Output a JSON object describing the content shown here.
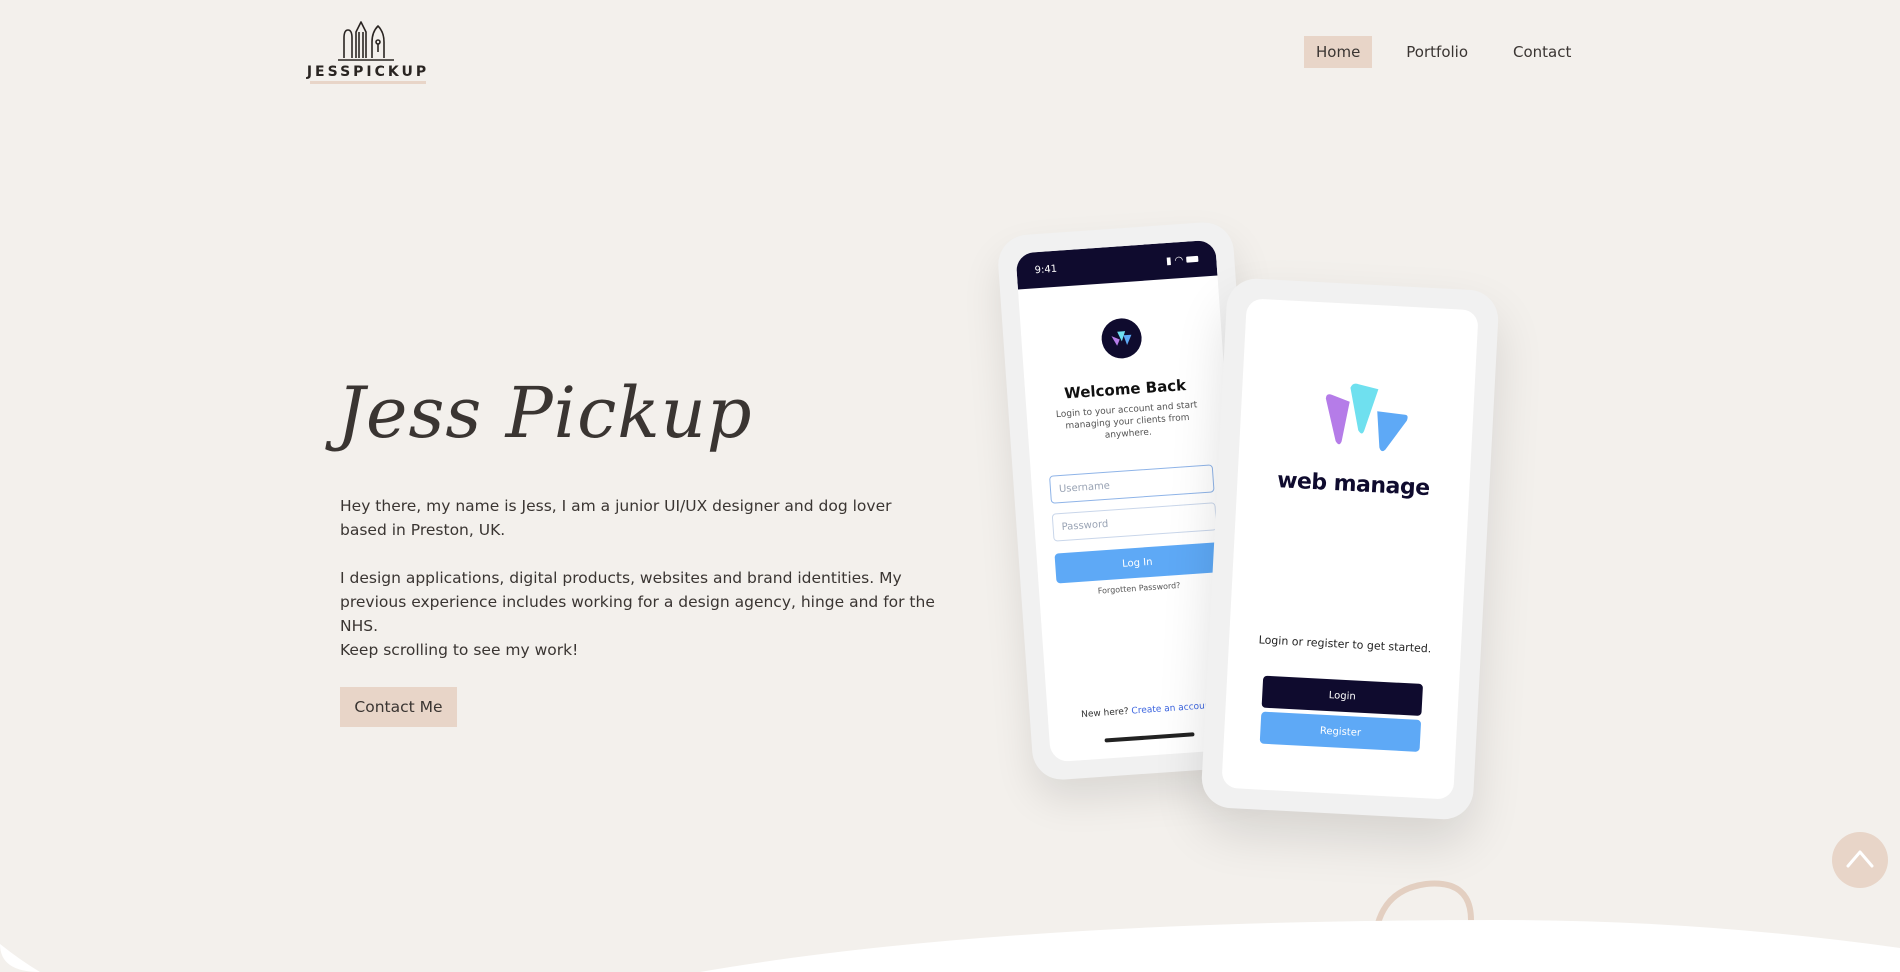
{
  "header": {
    "logo_text": "JESSPICKUP",
    "nav": [
      {
        "label": "Home",
        "active": true
      },
      {
        "label": "Portfolio",
        "active": false
      },
      {
        "label": "Contact",
        "active": false
      }
    ]
  },
  "hero": {
    "title": "Jess Pickup",
    "paragraphs": [
      "Hey there, my name is Jess, I am a junior UI/UX designer and dog lover based in Preston, UK.",
      "I design applications, digital products, websites and brand identities. My previous experience includes working for a design agency, hinge and for the NHS.",
      "Keep scrolling to see my work!"
    ],
    "cta_label": "Contact Me"
  },
  "mockup_login": {
    "time": "9:41",
    "heading": "Welcome Back",
    "subheading": "Login to your account and start managing your clients from anywhere.",
    "username_placeholder": "Username",
    "password_placeholder": "Password",
    "button": "Log In",
    "forgot": "Forgotten Password?",
    "new_here": "New here?",
    "create_link": "Create an account"
  },
  "mockup_splash": {
    "brand": "web manage",
    "tagline": "Login or register to get started.",
    "login_button": "Login",
    "register_button": "Register"
  },
  "colors": {
    "background": "#f3f0ec",
    "accent": "#e8d5c8",
    "navy": "#0f0b2e",
    "blue": "#5ea9f6"
  },
  "icons": {
    "logo": "pen-and-pencils-icon",
    "scroll_top": "chevron-up-icon"
  }
}
